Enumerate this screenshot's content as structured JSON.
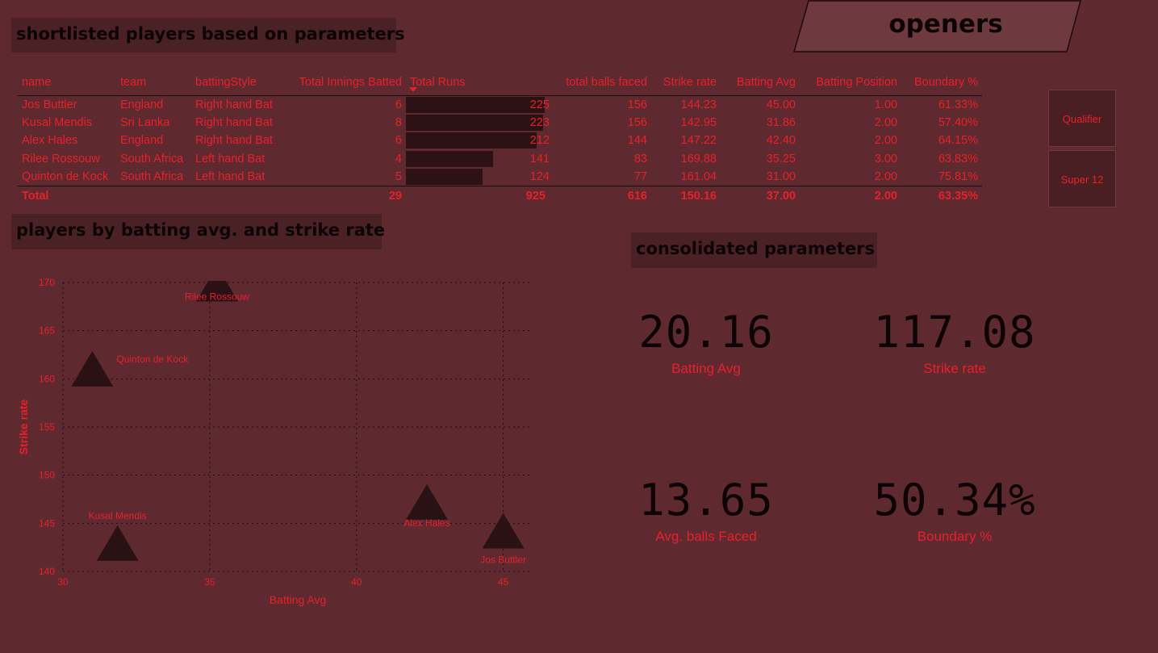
{
  "header": {
    "badge": "openers"
  },
  "shortlist": {
    "title": "shortlisted players based on parameters",
    "columns": [
      "name",
      "team",
      "battingStyle",
      "Total Innings Batted",
      "Total Runs",
      "total balls faced",
      "Strike rate",
      "Batting Avg",
      "Batting Position",
      "Boundary %"
    ],
    "rows": [
      {
        "name": "Jos Buttler",
        "team": "England",
        "style": "Right hand Bat",
        "innings": "6",
        "runs": "225",
        "runs_num": 225,
        "balls": "156",
        "sr": "144.23",
        "avg": "45.00",
        "pos": "1.00",
        "boundary": "61.33%"
      },
      {
        "name": "Kusal Mendis",
        "team": "Sri Lanka",
        "style": "Right hand Bat",
        "innings": "8",
        "runs": "223",
        "runs_num": 223,
        "balls": "156",
        "sr": "142.95",
        "avg": "31.86",
        "pos": "2.00",
        "boundary": "57.40%"
      },
      {
        "name": "Alex Hales",
        "team": "England",
        "style": "Right hand Bat",
        "innings": "6",
        "runs": "212",
        "runs_num": 212,
        "balls": "144",
        "sr": "147.22",
        "avg": "42.40",
        "pos": "2.00",
        "boundary": "64.15%"
      },
      {
        "name": "Rilee Rossouw",
        "team": "South Africa",
        "style": "Left hand Bat",
        "innings": "4",
        "runs": "141",
        "runs_num": 141,
        "balls": "83",
        "sr": "169.88",
        "avg": "35.25",
        "pos": "3.00",
        "boundary": "63.83%"
      },
      {
        "name": "Quinton de Kock",
        "team": "South Africa",
        "style": "Left hand Bat",
        "innings": "5",
        "runs": "124",
        "runs_num": 124,
        "balls": "77",
        "sr": "161.04",
        "avg": "31.00",
        "pos": "2.00",
        "boundary": "75.81%"
      }
    ],
    "total": {
      "label": "Total",
      "innings": "29",
      "runs": "925",
      "balls": "616",
      "sr": "150.16",
      "avg": "37.00",
      "pos": "2.00",
      "boundary": "63.35%"
    }
  },
  "slicers": {
    "qualifier": "Qualifier",
    "super12": "Super 12"
  },
  "scatter_title": "players by batting avg. and strike rate",
  "chart_data": {
    "type": "scatter",
    "title": "",
    "xlabel": "Batting Avg",
    "ylabel": "Strike rate",
    "xlim": [
      30,
      46
    ],
    "ylim": [
      140,
      170
    ],
    "x_ticks": [
      30,
      35,
      40,
      45
    ],
    "y_ticks": [
      140,
      145,
      150,
      155,
      160,
      165,
      170
    ],
    "grid": true,
    "points": [
      {
        "label": "Jos Buttler",
        "x": 45.0,
        "y": 144.23
      },
      {
        "label": "Kusal Mendis",
        "x": 31.86,
        "y": 142.95
      },
      {
        "label": "Alex Hales",
        "x": 42.4,
        "y": 147.22
      },
      {
        "label": "Rilee Rossouw",
        "x": 35.25,
        "y": 169.88
      },
      {
        "label": "Quinton de Kock",
        "x": 31.0,
        "y": 161.04
      }
    ]
  },
  "consolidated": {
    "title": "consolidated parameters",
    "kpis": [
      {
        "value": "20.16",
        "label": "Batting Avg"
      },
      {
        "value": "117.08",
        "label": "Strike rate"
      },
      {
        "value": "13.65",
        "label": "Avg. balls Faced"
      },
      {
        "value": "50.34%",
        "label": "Boundary %"
      }
    ]
  },
  "colors": {
    "background": "#5e2a2f",
    "accent": "#e8202a",
    "marker": "#2a1214",
    "title_bg": "#4a2226"
  }
}
